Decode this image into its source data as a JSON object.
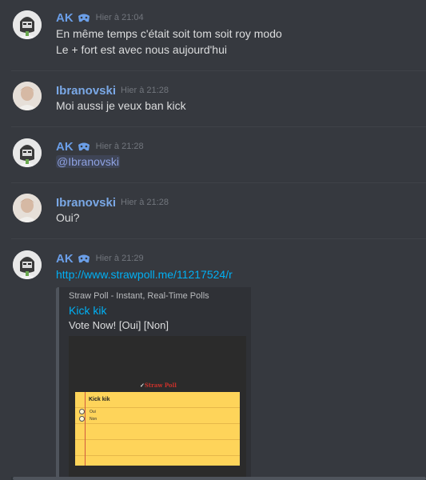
{
  "messages": [
    {
      "author": "AK",
      "timestamp": "Hier à 21:04",
      "lines": [
        "En même temps c'était soit tom soit roy modo",
        "Le + fort est avec nous aujourd'hui"
      ]
    },
    {
      "author": "Ibranovski",
      "timestamp": "Hier à 21:28",
      "lines": [
        "Moi aussi je veux ban kick"
      ]
    },
    {
      "author": "AK",
      "timestamp": "Hier à 21:28",
      "mention": "@Ibranovski"
    },
    {
      "author": "Ibranovski",
      "timestamp": "Hier à 21:28",
      "lines": [
        "Oui?"
      ]
    },
    {
      "author": "AK",
      "timestamp": "Hier à 21:29",
      "link": "http://www.strawpoll.me/11217524/r",
      "embed": {
        "provider": "Straw Poll - Instant, Real-Time Polls",
        "title": "Kick kik",
        "description": "Vote Now! [Oui] [Non]",
        "image": {
          "logo": "Straw Poll",
          "poll_title": "Kick kik",
          "options": [
            "Oui",
            "Non"
          ]
        }
      }
    }
  ],
  "icons": {
    "ak_badge": "game-controller-icon",
    "avatar_ak": "robot-avatar",
    "avatar_ibranovski": "portrait-avatar"
  },
  "colors": {
    "background": "#36393f",
    "username_blue": "#7aa8e6",
    "link": "#00b0f4",
    "embed_bg": "#2f3136",
    "poll_note": "#fed45a"
  }
}
